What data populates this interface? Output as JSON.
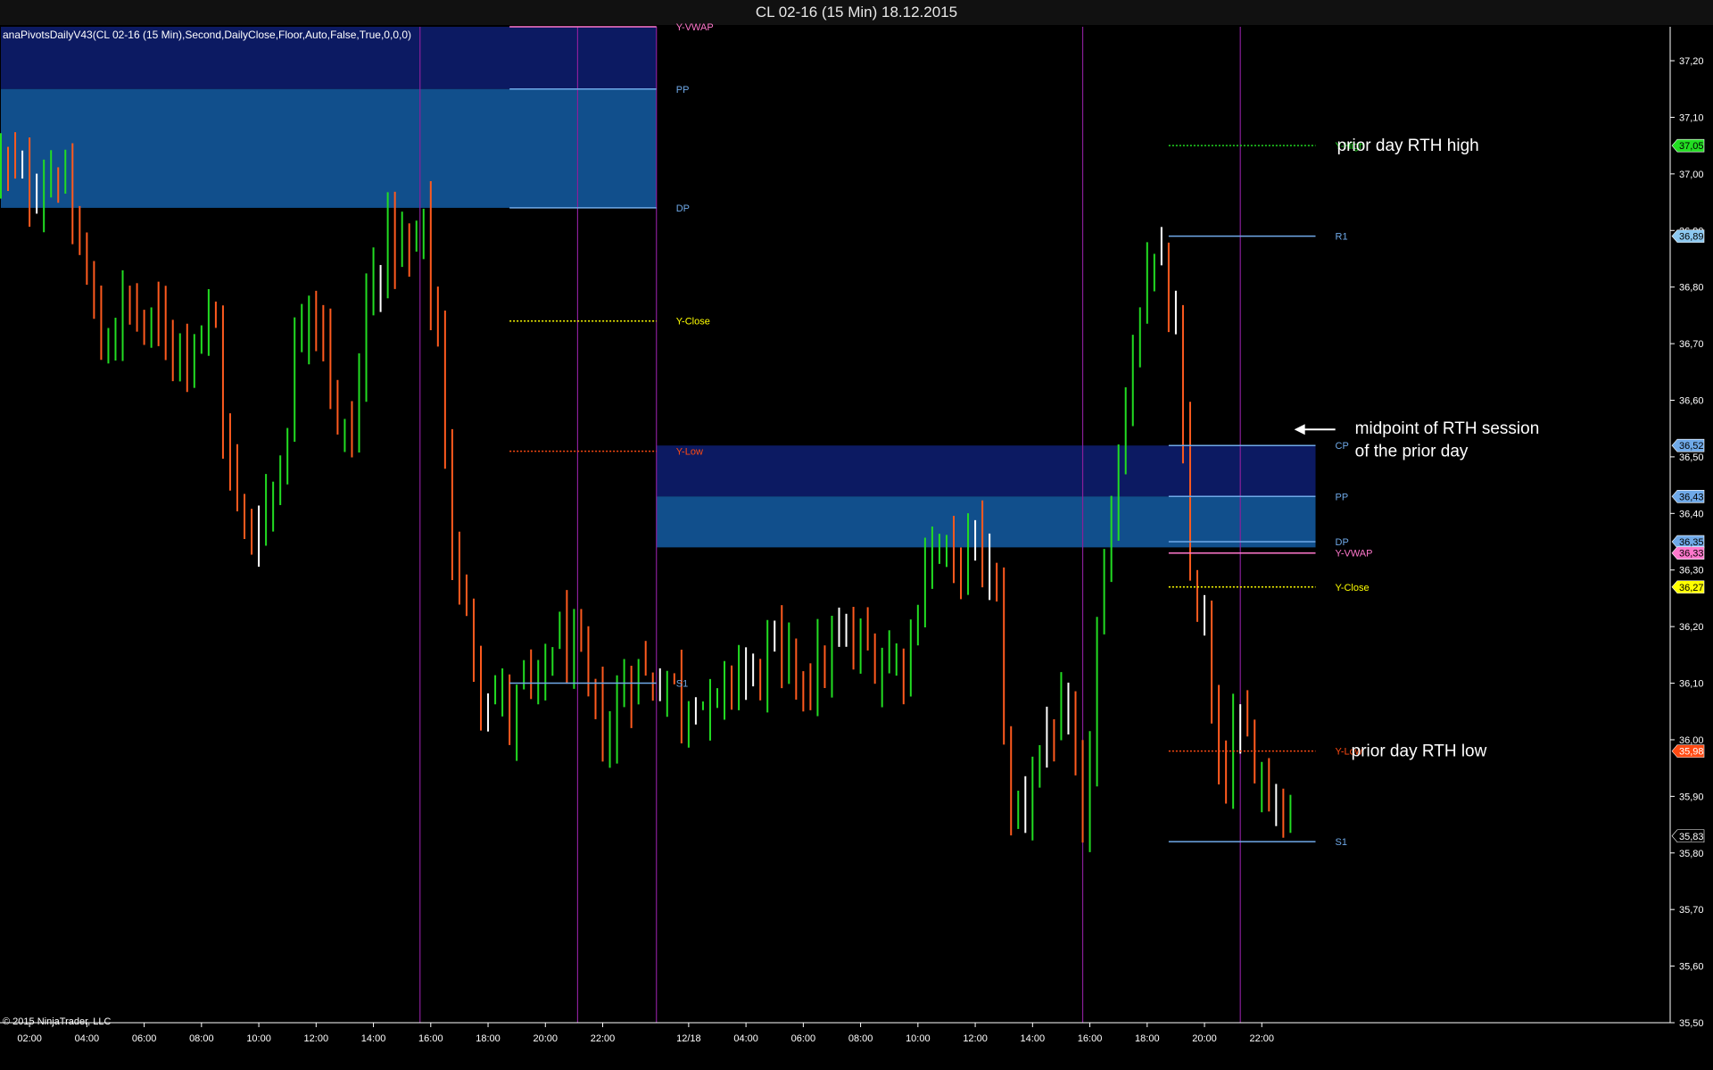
{
  "window": {
    "title": "CL 02-16 (15 Min)  18.12.2015"
  },
  "indicator_label": "anaPivotsDailyV43(CL 02-16 (15 Min),Second,DailyClose,Floor,Auto,False,True,0,0,0)",
  "copyright": "© 2015 NinjaTrader, LLC",
  "colors": {
    "background": "#000000",
    "up_bar": "#22dd22",
    "down_bar": "#ff5a1e",
    "doji_bar": "#ffffff",
    "session_line": "#8a1f9a",
    "zone_outer": "#0c1a62",
    "zone_inner": "#114f8c",
    "pivot_line": "#6fa9e8",
    "y_high": "#22dd22",
    "y_low": "#ff4a12",
    "y_close": "#ffff00",
    "y_vwap": "#ff77cc"
  },
  "chart_data": {
    "type": "candlestick",
    "instrument": "CL 02-16",
    "interval": "15 Min",
    "ylim": [
      35.5,
      37.26
    ],
    "y_ticks": [
      "37,20",
      "37,10",
      "37,00",
      "36,90",
      "36,80",
      "36,70",
      "36,60",
      "36,50",
      "36,40",
      "36,30",
      "36,20",
      "36,10",
      "36,00",
      "35,90",
      "35,80",
      "35,70",
      "35,60",
      "35,50"
    ],
    "x_ticks": [
      {
        "label": "02:00",
        "bar": 4
      },
      {
        "label": "04:00",
        "bar": 12
      },
      {
        "label": "06:00",
        "bar": 20
      },
      {
        "label": "08:00",
        "bar": 28
      },
      {
        "label": "10:00",
        "bar": 36
      },
      {
        "label": "12:00",
        "bar": 44
      },
      {
        "label": "14:00",
        "bar": 52
      },
      {
        "label": "16:00",
        "bar": 60
      },
      {
        "label": "18:00",
        "bar": 68
      },
      {
        "label": "20:00",
        "bar": 76
      },
      {
        "label": "22:00",
        "bar": 84
      },
      {
        "label": "12/18",
        "bar": 96
      },
      {
        "label": "04:00",
        "bar": 104
      },
      {
        "label": "06:00",
        "bar": 112
      },
      {
        "label": "08:00",
        "bar": 120
      },
      {
        "label": "10:00",
        "bar": 128
      },
      {
        "label": "12:00",
        "bar": 136
      },
      {
        "label": "14:00",
        "bar": 144
      },
      {
        "label": "16:00",
        "bar": 152
      },
      {
        "label": "18:00",
        "bar": 160
      },
      {
        "label": "20:00",
        "bar": 168
      },
      {
        "label": "22:00",
        "bar": 176
      }
    ],
    "bar_count": 181,
    "session_lines": [
      {
        "bar": 58.5
      },
      {
        "bar": 80.5
      },
      {
        "bar": 91.5
      },
      {
        "bar": 151
      },
      {
        "bar": 173
      }
    ],
    "zones": [
      {
        "from_bar": 0,
        "to_bar": 91.5,
        "top": 37.26,
        "bottom": 37.15,
        "kind": "outer"
      },
      {
        "from_bar": 0,
        "to_bar": 91.5,
        "top": 37.15,
        "bottom": 36.94,
        "kind": "inner"
      },
      {
        "from_bar": 91.5,
        "to_bar": 183.5,
        "top": 36.52,
        "bottom": 36.43,
        "kind": "outer"
      },
      {
        "from_bar": 91.5,
        "to_bar": 183.5,
        "top": 36.43,
        "bottom": 36.34,
        "kind": "inner"
      }
    ],
    "levels": [
      {
        "label": "Y-VWAP",
        "value": 37.26,
        "from_bar": 71,
        "to_bar": 91.5,
        "style": "solid",
        "color": "y_vwap"
      },
      {
        "label": "PP",
        "value": 37.15,
        "from_bar": 71,
        "to_bar": 91.5,
        "style": "solid",
        "color": "pivot_line"
      },
      {
        "label": "DP",
        "value": 36.94,
        "from_bar": 71,
        "to_bar": 91.5,
        "style": "solid",
        "color": "pivot_line"
      },
      {
        "label": "Y-Close",
        "value": 36.74,
        "from_bar": 71,
        "to_bar": 91.5,
        "style": "dotted",
        "color": "y_close"
      },
      {
        "label": "Y-Low",
        "value": 36.51,
        "from_bar": 71,
        "to_bar": 91.5,
        "style": "dotted",
        "color": "y_low"
      },
      {
        "label": "S1",
        "value": 36.1,
        "from_bar": 71,
        "to_bar": 91.5,
        "style": "solid",
        "color": "pivot_line"
      },
      {
        "label": "Y-High",
        "value": 37.05,
        "from_bar": 163,
        "to_bar": 183.5,
        "style": "dotted",
        "color": "y_high"
      },
      {
        "label": "R1",
        "value": 36.89,
        "from_bar": 163,
        "to_bar": 183.5,
        "style": "solid",
        "color": "pivot_line"
      },
      {
        "label": "CP",
        "value": 36.52,
        "from_bar": 163,
        "to_bar": 183.5,
        "style": "solid",
        "color": "pivot_line"
      },
      {
        "label": "PP",
        "value": 36.43,
        "from_bar": 163,
        "to_bar": 183.5,
        "style": "solid",
        "color": "pivot_line"
      },
      {
        "label": "DP",
        "value": 36.35,
        "from_bar": 163,
        "to_bar": 183.5,
        "style": "solid",
        "color": "pivot_line"
      },
      {
        "label": "Y-VWAP",
        "value": 36.33,
        "from_bar": 163,
        "to_bar": 183.5,
        "style": "solid",
        "color": "y_vwap"
      },
      {
        "label": "Y-Close",
        "value": 36.27,
        "from_bar": 163,
        "to_bar": 183.5,
        "style": "dotted",
        "color": "y_close"
      },
      {
        "label": "Y-Low",
        "value": 35.98,
        "from_bar": 163,
        "to_bar": 183.5,
        "style": "dotted",
        "color": "y_low"
      },
      {
        "label": "S1",
        "value": 35.82,
        "from_bar": 163,
        "to_bar": 183.5,
        "style": "solid",
        "color": "pivot_line"
      }
    ],
    "price_tags": [
      {
        "label": "37,05",
        "value": 37.05,
        "bg": "#22dd22",
        "fg": "#000000"
      },
      {
        "label": "36,89",
        "value": 36.89,
        "bg": "#8cc8f0",
        "fg": "#000000"
      },
      {
        "label": "36,52",
        "value": 36.52,
        "bg": "#6fa9e8",
        "fg": "#000000"
      },
      {
        "label": "36,43",
        "value": 36.43,
        "bg": "#6fa9e8",
        "fg": "#000000"
      },
      {
        "label": "36,35",
        "value": 36.35,
        "bg": "#6fa9e8",
        "fg": "#000000"
      },
      {
        "label": "36,33",
        "value": 36.33,
        "bg": "#ff77cc",
        "fg": "#000000"
      },
      {
        "label": "36,27",
        "value": 36.27,
        "bg": "#ffff00",
        "fg": "#000000"
      },
      {
        "label": "35,98",
        "value": 35.98,
        "bg": "#ff4a12",
        "fg": "#ffffff"
      },
      {
        "label": "35,83",
        "value": 35.83,
        "bg": "#000000",
        "fg": "#ffffff"
      }
    ],
    "annotations": [
      {
        "text": "prior day RTH high",
        "value": 37.05,
        "bar": 186.5,
        "arrow": false
      },
      {
        "text": "midpoint of RTH session",
        "value": 36.55,
        "bar": 189,
        "arrow": true
      },
      {
        "text": "of the prior day",
        "value": 36.51,
        "bar": 189,
        "arrow": false
      },
      {
        "text": "prior day RTH low",
        "value": 35.98,
        "bar": 188.5,
        "arrow": false
      }
    ],
    "anchors": [
      [
        0,
        37.02
      ],
      [
        3,
        36.98
      ],
      [
        6,
        36.99
      ],
      [
        8,
        37.01
      ],
      [
        10,
        36.9
      ],
      [
        12,
        36.82
      ],
      [
        14,
        36.68
      ],
      [
        17,
        36.77
      ],
      [
        20,
        36.73
      ],
      [
        23,
        36.72
      ],
      [
        26,
        36.7
      ],
      [
        28,
        36.74
      ],
      [
        30,
        36.72
      ],
      [
        31,
        36.56
      ],
      [
        33,
        36.4
      ],
      [
        35,
        36.36
      ],
      [
        37,
        36.42
      ],
      [
        39,
        36.48
      ],
      [
        41,
        36.68
      ],
      [
        43,
        36.8
      ],
      [
        45,
        36.74
      ],
      [
        47,
        36.53
      ],
      [
        49,
        36.54
      ],
      [
        51,
        36.76
      ],
      [
        54,
        36.9
      ],
      [
        57,
        36.85
      ],
      [
        59,
        36.9
      ],
      [
        61,
        36.7
      ],
      [
        63,
        36.34
      ],
      [
        65,
        36.2
      ],
      [
        67,
        36.11
      ],
      [
        69,
        36.08
      ],
      [
        71,
        36.04
      ],
      [
        73,
        36.1
      ],
      [
        75,
        36.07
      ],
      [
        77,
        36.18
      ],
      [
        79,
        36.17
      ],
      [
        81,
        36.12
      ],
      [
        83,
        36.04
      ],
      [
        85,
        36.0
      ],
      [
        87,
        36.11
      ],
      [
        89,
        36.12
      ],
      [
        91,
        36.1
      ],
      [
        93,
        36.12
      ],
      [
        95,
        36.06
      ],
      [
        97,
        36.1
      ],
      [
        99,
        36.04
      ],
      [
        101,
        36.08
      ],
      [
        103,
        36.14
      ],
      [
        105,
        36.1
      ],
      [
        107,
        36.16
      ],
      [
        109,
        36.12
      ],
      [
        111,
        36.14
      ],
      [
        113,
        36.1
      ],
      [
        115,
        36.14
      ],
      [
        117,
        36.17
      ],
      [
        119,
        36.16
      ],
      [
        121,
        36.16
      ],
      [
        123,
        36.14
      ],
      [
        125,
        36.14
      ],
      [
        127,
        36.18
      ],
      [
        129,
        36.32
      ],
      [
        131,
        36.34
      ],
      [
        133,
        36.3
      ],
      [
        135,
        36.34
      ],
      [
        137,
        36.34
      ],
      [
        139,
        36.23
      ],
      [
        141,
        35.85
      ],
      [
        143,
        35.9
      ],
      [
        145,
        35.99
      ],
      [
        147,
        36.02
      ],
      [
        149,
        36.02
      ],
      [
        151,
        35.82
      ],
      [
        153,
        36.18
      ],
      [
        155,
        36.36
      ],
      [
        156,
        36.5
      ],
      [
        158,
        36.7
      ],
      [
        160,
        36.85
      ],
      [
        162,
        36.82
      ],
      [
        164,
        36.7
      ],
      [
        165,
        36.5
      ],
      [
        166,
        36.3
      ],
      [
        168,
        36.18
      ],
      [
        169,
        36.05
      ],
      [
        170,
        35.91
      ],
      [
        172,
        36.0
      ],
      [
        174,
        35.99
      ],
      [
        176,
        35.95
      ],
      [
        178,
        35.9
      ],
      [
        180,
        35.87
      ]
    ]
  }
}
